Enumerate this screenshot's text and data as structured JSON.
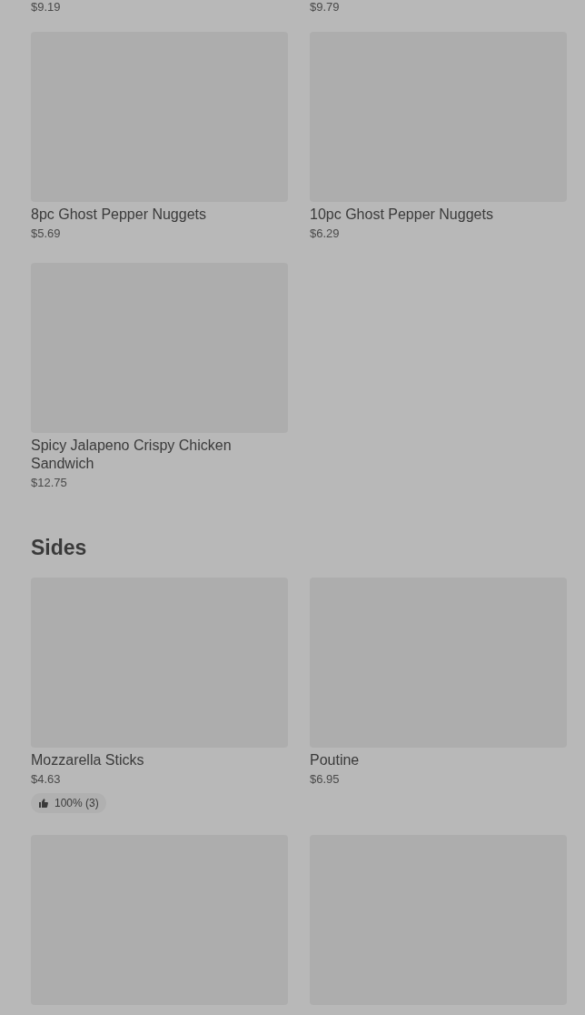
{
  "cut_prices": [
    "$9.19",
    "$9.79"
  ],
  "items": [
    {
      "kind": "item",
      "name": "8pc Ghost Pepper Nuggets",
      "price": "$5.69"
    },
    {
      "kind": "item",
      "name": "10pc Ghost Pepper Nuggets",
      "price": "$6.29"
    },
    {
      "kind": "item",
      "name": "Spicy Jalapeno Crispy Chicken Sandwich",
      "price": "$12.75"
    }
  ],
  "sides": {
    "title": "Sides",
    "items": [
      {
        "kind": "item",
        "name": "Mozzarella Sticks",
        "price": "$4.63",
        "rating": "100% (3)"
      },
      {
        "kind": "item",
        "name": "Poutine",
        "price": "$6.95"
      },
      {
        "kind": "cut"
      },
      {
        "kind": "cut"
      }
    ]
  }
}
